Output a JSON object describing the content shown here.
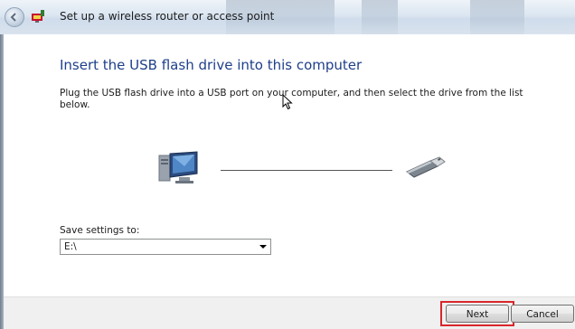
{
  "window": {
    "title": "Set up a wireless router or access point"
  },
  "main": {
    "heading": "Insert the USB flash drive into this computer",
    "instruction": "Plug the USB flash drive into a USB port on your computer, and then select the drive from the list below.",
    "save_label": "Save settings to:",
    "drive_value": "E:\\"
  },
  "footer": {
    "next_label": "Next",
    "cancel_label": "Cancel"
  },
  "icons": {
    "back": "back-arrow-icon",
    "wizard": "wireless-network-icon",
    "computer": "computer-icon",
    "usb": "usb-flash-drive-icon",
    "cursor": "mouse-cursor-icon"
  },
  "colors": {
    "heading": "#1e3f8a",
    "highlight": "#d9262a"
  }
}
